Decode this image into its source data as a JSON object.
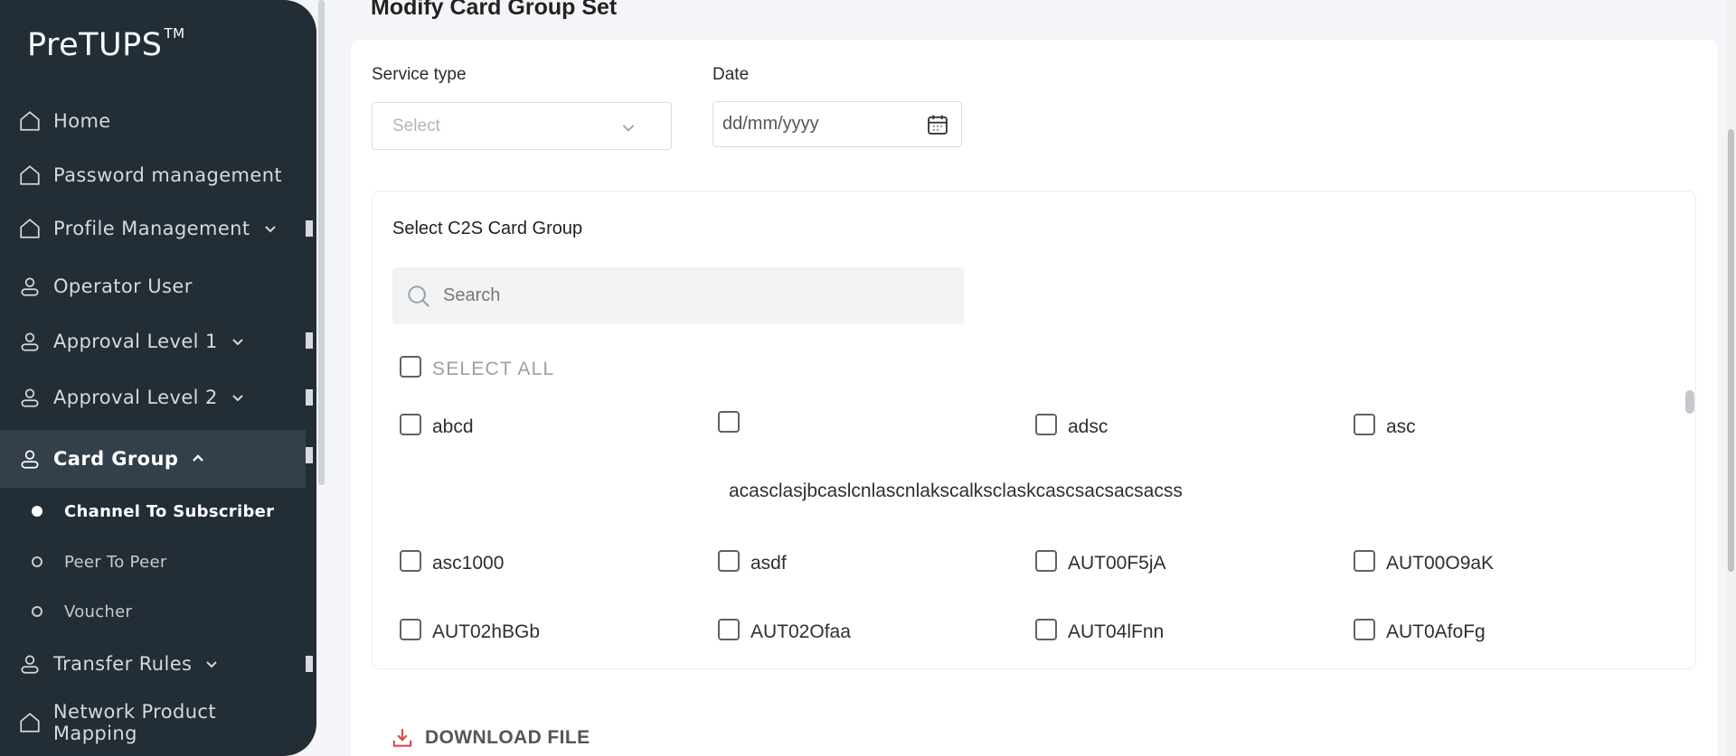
{
  "app": {
    "logo": "PreTUPS",
    "logo_tm": "TM"
  },
  "sidebar": {
    "items": [
      {
        "label": "Home",
        "icon": "home-icon",
        "expandable": false
      },
      {
        "label": "Password management",
        "icon": "home-icon",
        "expandable": false
      },
      {
        "label": "Profile Management",
        "icon": "home-icon",
        "expandable": true
      },
      {
        "label": "Operator User",
        "icon": "user-icon",
        "expandable": false
      },
      {
        "label": "Approval Level 1",
        "icon": "user-icon",
        "expandable": true
      },
      {
        "label": "Approval Level 2",
        "icon": "user-icon",
        "expandable": true
      },
      {
        "label": "Card Group",
        "icon": "user-icon",
        "expandable": true,
        "expanded": true,
        "active": true
      },
      {
        "label": "Transfer Rules",
        "icon": "user-icon",
        "expandable": true
      },
      {
        "label": "Network Product Mapping",
        "icon": "home-icon",
        "expandable": false
      }
    ],
    "card_group_children": [
      {
        "label": "Channel To Subscriber",
        "active": true
      },
      {
        "label": "Peer To Peer",
        "active": false
      },
      {
        "label": "Voucher",
        "active": false
      }
    ]
  },
  "main": {
    "title": "Modify Card Group Set",
    "service_type": {
      "label": "Service type",
      "placeholder": "Select"
    },
    "date": {
      "label": "Date",
      "placeholder": "dd/mm/yyyy"
    },
    "card_group": {
      "title": "Select C2S Card Group",
      "search_placeholder": "Search",
      "select_all": "SELECT ALL",
      "options": [
        "abcd",
        "",
        "adsc",
        "asc",
        "asc1000",
        "asdf",
        "AUT00F5jA",
        "AUT00O9aK",
        "AUT02hBGb",
        "AUT02Ofaa",
        "AUT04lFnn",
        "AUT0AfoFg"
      ],
      "long_option": "acasclasjbcaslcnlascnlakscalksclaskcascsacsacsacss"
    },
    "download_label": "DOWNLOAD FILE"
  },
  "colors": {
    "sidebar_bg": "#222d36",
    "sidebar_active": "#333f4a",
    "download_icon": "#e0474c"
  }
}
